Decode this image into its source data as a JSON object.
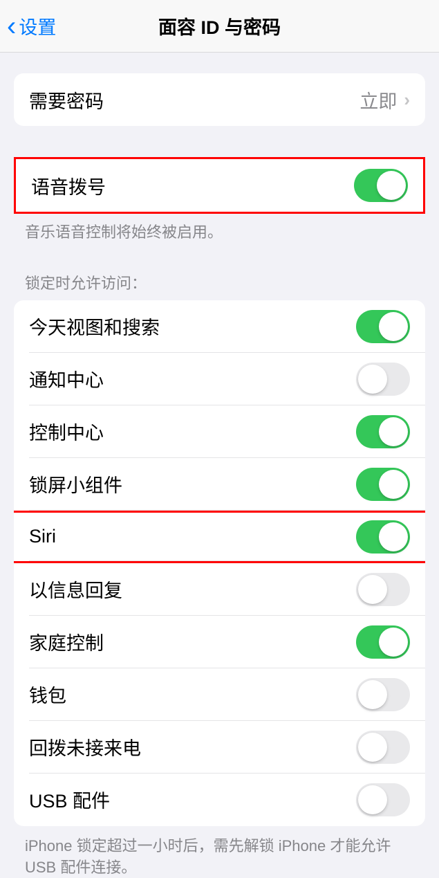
{
  "header": {
    "back_label": "设置",
    "title": "面容 ID 与密码"
  },
  "passcode_row": {
    "label": "需要密码",
    "value": "立即"
  },
  "voice_dial": {
    "label": "语音拨号",
    "on": true,
    "footer": "音乐语音控制将始终被启用。"
  },
  "lock_section": {
    "header": "锁定时允许访问：",
    "items": [
      {
        "label": "今天视图和搜索",
        "on": true,
        "highlight": false
      },
      {
        "label": "通知中心",
        "on": false,
        "highlight": false
      },
      {
        "label": "控制中心",
        "on": true,
        "highlight": false
      },
      {
        "label": "锁屏小组件",
        "on": true,
        "highlight": false
      },
      {
        "label": "Siri",
        "on": true,
        "highlight": true
      },
      {
        "label": "以信息回复",
        "on": false,
        "highlight": false
      },
      {
        "label": "家庭控制",
        "on": true,
        "highlight": false
      },
      {
        "label": "钱包",
        "on": false,
        "highlight": false
      },
      {
        "label": "回拨未接来电",
        "on": false,
        "highlight": false
      },
      {
        "label": "USB 配件",
        "on": false,
        "highlight": false
      }
    ],
    "footer": "iPhone 锁定超过一小时后，需先解锁 iPhone 才能允许 USB 配件连接。"
  }
}
